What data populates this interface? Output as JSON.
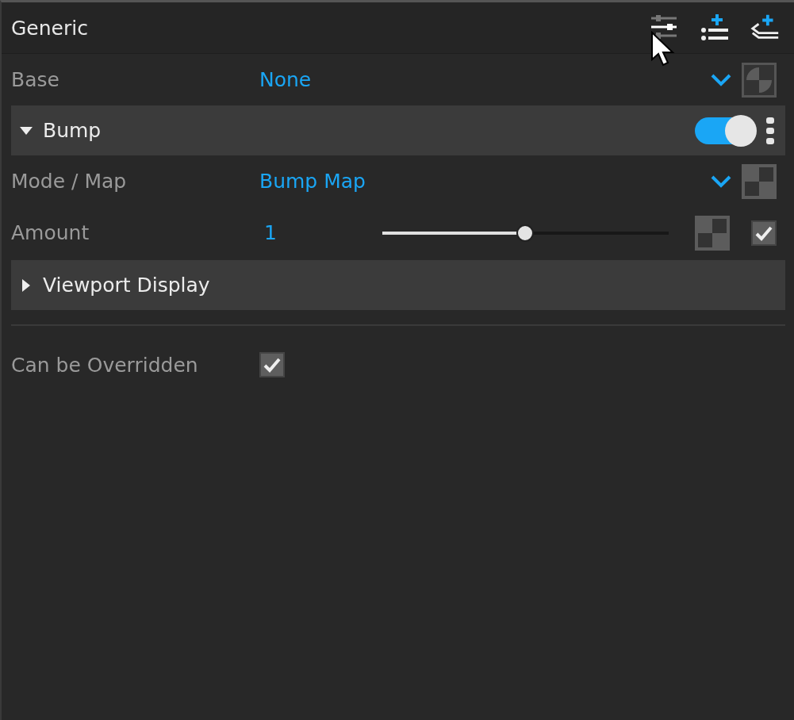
{
  "panel": {
    "title": "Generic"
  },
  "rows": [
    {
      "kind": "dropdown",
      "label": "Base",
      "value": "None",
      "map_slot": {
        "kind": "round"
      }
    }
  ],
  "sections": [
    {
      "title": "Bump",
      "expanded": true,
      "enabled": true,
      "rows": [
        {
          "kind": "dropdown",
          "label": "Mode / Map",
          "value": "Bump Map",
          "map_slot": {
            "kind": "square"
          }
        },
        {
          "kind": "slider",
          "label": "Amount",
          "value": "1",
          "level": 0.5,
          "checked": true
        }
      ]
    },
    {
      "title": "Viewport Display",
      "expanded": false
    }
  ],
  "override": {
    "label": "Can be Overridden",
    "checked": true
  }
}
